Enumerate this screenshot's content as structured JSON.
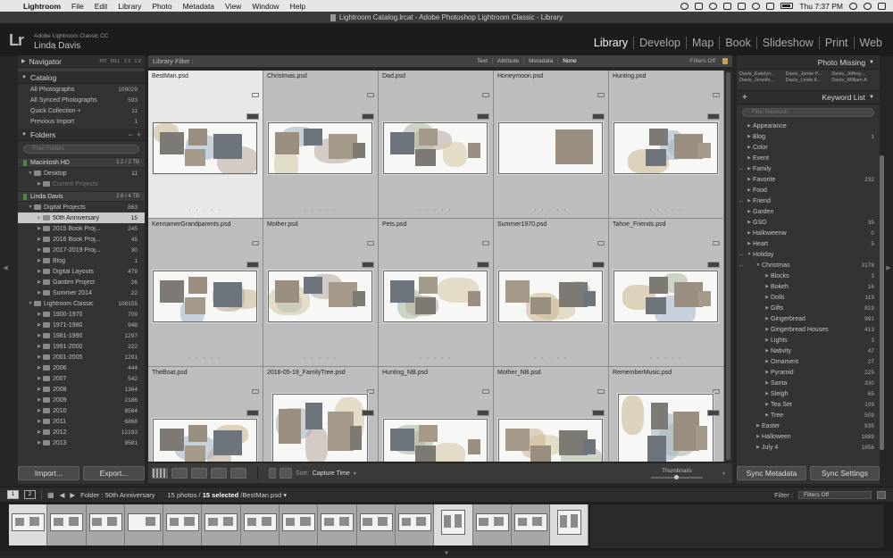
{
  "menubar": {
    "app": "Lightroom",
    "items": [
      "File",
      "Edit",
      "Library",
      "Photo",
      "Metadata",
      "View",
      "Window",
      "Help"
    ],
    "clock": "Thu 7:37 PM"
  },
  "window_title": "Lightroom Catalog.lrcat - Adobe Photoshop Lightroom Classic - Library",
  "identity": {
    "logo": "Lr",
    "product": "Adobe Lightroom Classic CC",
    "user": "Linda Davis"
  },
  "modules": [
    "Library",
    "Develop",
    "Map",
    "Book",
    "Slideshow",
    "Print",
    "Web"
  ],
  "navigator": {
    "title": "Navigator",
    "zoom": [
      "FIT",
      "FILL",
      "1:1",
      "1:2"
    ]
  },
  "catalog": {
    "title": "Catalog",
    "items": [
      {
        "label": "All Photographs",
        "count": "109029"
      },
      {
        "label": "All Synced Photographs",
        "count": "593"
      },
      {
        "label": "Quick Collection +",
        "count": "11"
      },
      {
        "label": "Previous Import",
        "count": "1"
      }
    ]
  },
  "folders": {
    "title": "Folders",
    "search_placeholder": "Filter Folders",
    "volume1": {
      "name": "Macintosh HD",
      "space": "1.2 / 2 TB"
    },
    "vol1_items": [
      {
        "label": "Desktop",
        "count": "11",
        "indent": 1
      },
      {
        "label": "Current Projects",
        "count": "",
        "indent": 2,
        "dim": true
      }
    ],
    "volume2": {
      "name": "Linda Davis",
      "space": "2.6 / 4 TB"
    },
    "vol2_items": [
      {
        "label": "Digital Projects",
        "count": "863",
        "indent": 1
      },
      {
        "label": "50th Anniversary",
        "count": "15",
        "indent": 2,
        "selected": true
      },
      {
        "label": "2015 Book Proj...",
        "count": "245",
        "indent": 2
      },
      {
        "label": "2016 Book Proj...",
        "count": "45",
        "indent": 2
      },
      {
        "label": "2017-2019 Proj...",
        "count": "30",
        "indent": 2
      },
      {
        "label": "Blog",
        "count": "1",
        "indent": 2
      },
      {
        "label": "Digital Layouts",
        "count": "479",
        "indent": 2
      },
      {
        "label": "Garden Project",
        "count": "26",
        "indent": 2
      },
      {
        "label": "Summer 2014",
        "count": "22",
        "indent": 2
      },
      {
        "label": "Lightroom Classic",
        "count": "108155",
        "indent": 1
      },
      {
        "label": "1900-1970",
        "count": "709",
        "indent": 2
      },
      {
        "label": "1971-1980",
        "count": "948",
        "indent": 2
      },
      {
        "label": "1981-1990",
        "count": "1297",
        "indent": 2
      },
      {
        "label": "1991-2000",
        "count": "222",
        "indent": 2
      },
      {
        "label": "2001-2005",
        "count": "1291",
        "indent": 2
      },
      {
        "label": "2006",
        "count": "444",
        "indent": 2
      },
      {
        "label": "2007",
        "count": "542",
        "indent": 2
      },
      {
        "label": "2008",
        "count": "1364",
        "indent": 2
      },
      {
        "label": "2009",
        "count": "2186",
        "indent": 2
      },
      {
        "label": "2010",
        "count": "8584",
        "indent": 2
      },
      {
        "label": "2011",
        "count": "6868",
        "indent": 2
      },
      {
        "label": "2012",
        "count": "12193",
        "indent": 2
      },
      {
        "label": "2013",
        "count": "9581",
        "indent": 2
      }
    ]
  },
  "left_buttons": {
    "import": "Import...",
    "export": "Export..."
  },
  "filter_bar": {
    "label": "Library Filter :",
    "options": [
      "Text",
      "Attribute",
      "Metadata",
      "None"
    ],
    "active": "None",
    "status": "Filters Off"
  },
  "grid_items": [
    {
      "name": "BestMan.psd",
      "selected": true
    },
    {
      "name": "Christmas.psd"
    },
    {
      "name": "Dad.psd"
    },
    {
      "name": "Honeymoon.psd"
    },
    {
      "name": "Hunting.psd"
    },
    {
      "name": "KennamerGrandparents.psd"
    },
    {
      "name": "Mother.psd"
    },
    {
      "name": "Pets.psd"
    },
    {
      "name": "Summer1970.psd"
    },
    {
      "name": "Tahoe_Friends.psd"
    },
    {
      "name": "TheBoat.psd"
    },
    {
      "name": "2018-05-19_FamilyTree.psd",
      "tall": true
    },
    {
      "name": "Hunting_NB.psd"
    },
    {
      "name": "Mother_NB.psd"
    },
    {
      "name": "RememberMusic.psd",
      "tall": true
    }
  ],
  "toolbar": {
    "sort_label": "Sort:",
    "sort_value": "Capture Time",
    "thumbnails_label": "Thumbnails"
  },
  "right_panel": {
    "photo_missing": "Photo Missing",
    "suggestions": [
      "Davis_Katelyn...",
      "Davis_Jamie P...",
      "Davis_Jeffrey...",
      "Davis_Jennife...",
      "Davis_Linda K...",
      "Davis_William A"
    ],
    "keyword_list_title": "Keyword List",
    "keyword_filter_placeholder": "Filter Keywords",
    "keywords": [
      {
        "label": "Appearance",
        "count": "",
        "level": 1
      },
      {
        "label": "Blog",
        "count": "1",
        "level": 1
      },
      {
        "label": "Color",
        "count": "",
        "level": 1
      },
      {
        "label": "Event",
        "count": "",
        "level": 1
      },
      {
        "label": "Family",
        "count": "",
        "level": 1,
        "dash": true
      },
      {
        "label": "Favorite",
        "count": "232",
        "level": 1
      },
      {
        "label": "Food",
        "count": "",
        "level": 1
      },
      {
        "label": "Friend",
        "count": "",
        "level": 1,
        "dash": true
      },
      {
        "label": "Garden",
        "count": "",
        "level": 1
      },
      {
        "label": "GSO",
        "count": "35",
        "level": 1
      },
      {
        "label": "Halloweenw",
        "count": "0",
        "level": 1
      },
      {
        "label": "Heart",
        "count": "5",
        "level": 1
      },
      {
        "label": "Holiday",
        "count": "",
        "level": 1,
        "dash": true,
        "open": true
      },
      {
        "label": "Christmas",
        "count": "3178",
        "level": 2,
        "dash": true,
        "open": true
      },
      {
        "label": "Blocks",
        "count": "3",
        "level": 3
      },
      {
        "label": "Bokeh",
        "count": "16",
        "level": 3
      },
      {
        "label": "Dolls",
        "count": "119",
        "level": 3
      },
      {
        "label": "Gifts",
        "count": "819",
        "level": 3
      },
      {
        "label": "Gingerbread",
        "count": "991",
        "level": 3
      },
      {
        "label": "Gingerbread Houses",
        "count": "413",
        "level": 3
      },
      {
        "label": "Lights",
        "count": "3",
        "level": 3
      },
      {
        "label": "Nativity",
        "count": "47",
        "level": 3
      },
      {
        "label": "Ornament",
        "count": "27",
        "level": 3
      },
      {
        "label": "Pyramid",
        "count": "225",
        "level": 3
      },
      {
        "label": "Santa",
        "count": "330",
        "level": 3
      },
      {
        "label": "Sleigh",
        "count": "65",
        "level": 3
      },
      {
        "label": "Tea Set",
        "count": "109",
        "level": 3
      },
      {
        "label": "Tree",
        "count": "509",
        "level": 3
      },
      {
        "label": "Easter",
        "count": "935",
        "level": 2
      },
      {
        "label": "Halloween",
        "count": "1889",
        "level": 2
      },
      {
        "label": "July 4",
        "count": "1856",
        "level": 2
      }
    ]
  },
  "right_buttons": {
    "sync_metadata": "Sync Metadata",
    "sync_settings": "Sync Settings"
  },
  "filmstrip_header": {
    "screen1": "1",
    "screen2": "2",
    "folder": "Folder : 50th Anniversary",
    "photos": "15 photos / ",
    "selected": "15 selected",
    "file": " /BestMan.psd",
    "filter_label": "Filter :",
    "filter_value": "Filters Off"
  },
  "colors": {
    "accent_selected_cell": "#e8e8e8",
    "selected_folder": "#c9c9c9",
    "volume_led": "#4a8a3a",
    "lock": "#c8a44a"
  }
}
